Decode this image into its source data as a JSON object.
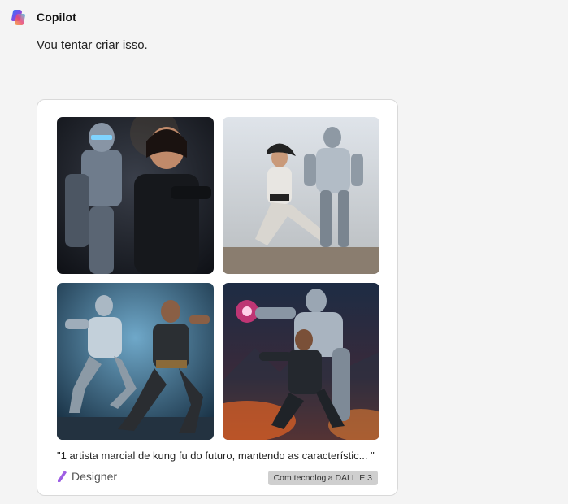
{
  "assistant": {
    "name": "Copilot",
    "logo_icon": "copilot-logo-icon"
  },
  "message": {
    "text": "Vou tentar criar isso."
  },
  "image_card": {
    "images": [
      {
        "label": "kung-fu-robot-image-1"
      },
      {
        "label": "kung-fu-robot-image-2"
      },
      {
        "label": "kung-fu-robot-image-3"
      },
      {
        "label": "kung-fu-robot-image-4"
      }
    ],
    "caption": "\"1 artista marcial de kung fu do futuro, mantendo as característic... \"",
    "source_label": "Designer",
    "source_icon": "designer-icon",
    "badge": "Com tecnologia DALL·E 3"
  },
  "colors": {
    "background": "#f4f4f4",
    "card_border": "#d9d9d9",
    "badge_bg": "#cfcfcf"
  }
}
